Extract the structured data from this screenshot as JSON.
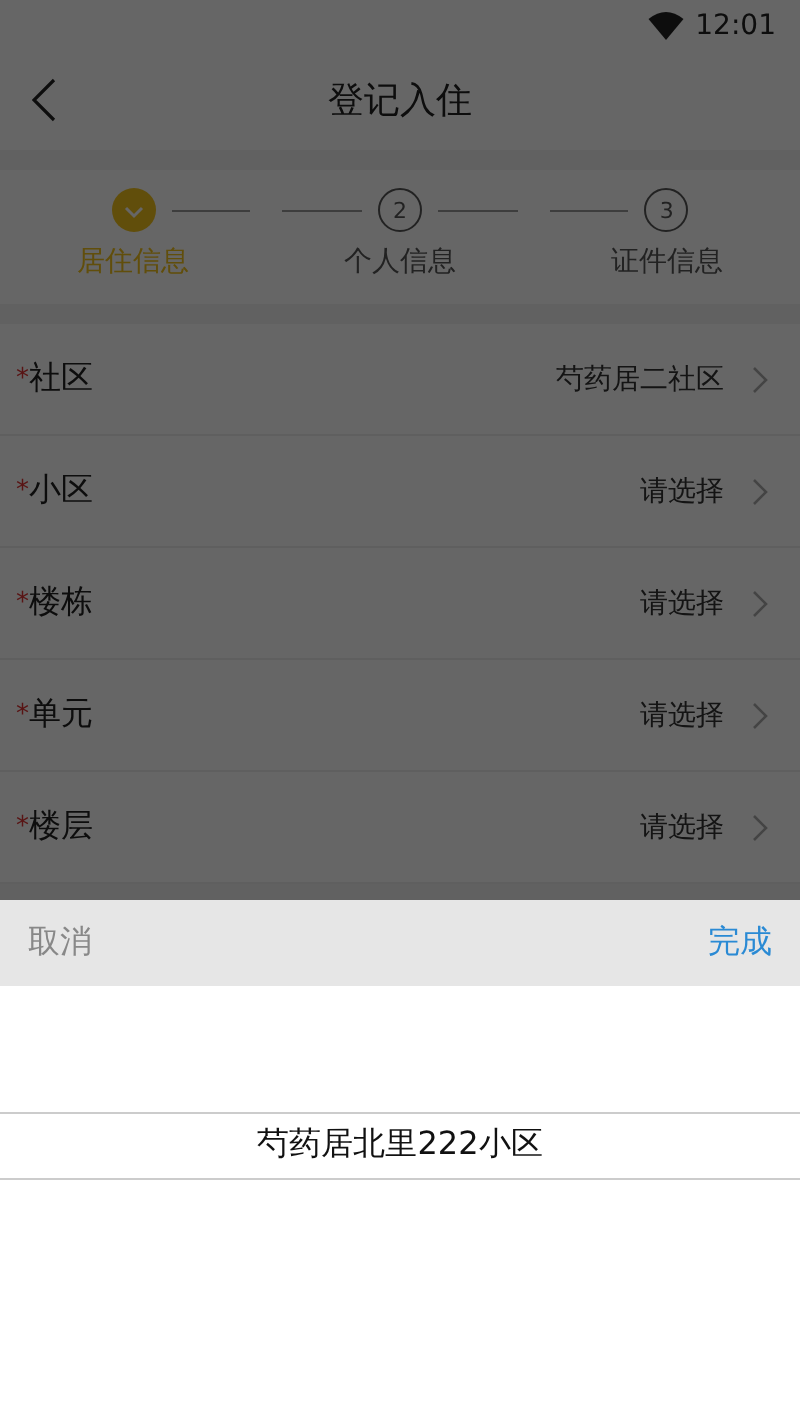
{
  "status_bar": {
    "time": "12:01"
  },
  "header": {
    "title": "登记入住"
  },
  "steps": [
    {
      "label": "居住信息",
      "selected": true,
      "done": true
    },
    {
      "label": "个人信息",
      "number": "2",
      "selected": false,
      "done": false
    },
    {
      "label": "证件信息",
      "number": "3",
      "selected": false,
      "done": false
    }
  ],
  "form": {
    "rows": [
      {
        "required_mark": "*",
        "label": "社区",
        "value": "芍药居二社区"
      },
      {
        "required_mark": "*",
        "label": "小区",
        "placeholder": "请选择"
      },
      {
        "required_mark": "*",
        "label": "楼栋",
        "placeholder": "请选择"
      },
      {
        "required_mark": "*",
        "label": "单元",
        "placeholder": "请选择"
      },
      {
        "required_mark": "*",
        "label": "楼层",
        "placeholder": "请选择"
      }
    ]
  },
  "picker": {
    "cancel": "取消",
    "done": "完成",
    "options": [
      {
        "label": "芍药居北里222小区",
        "selected": true
      }
    ]
  }
}
